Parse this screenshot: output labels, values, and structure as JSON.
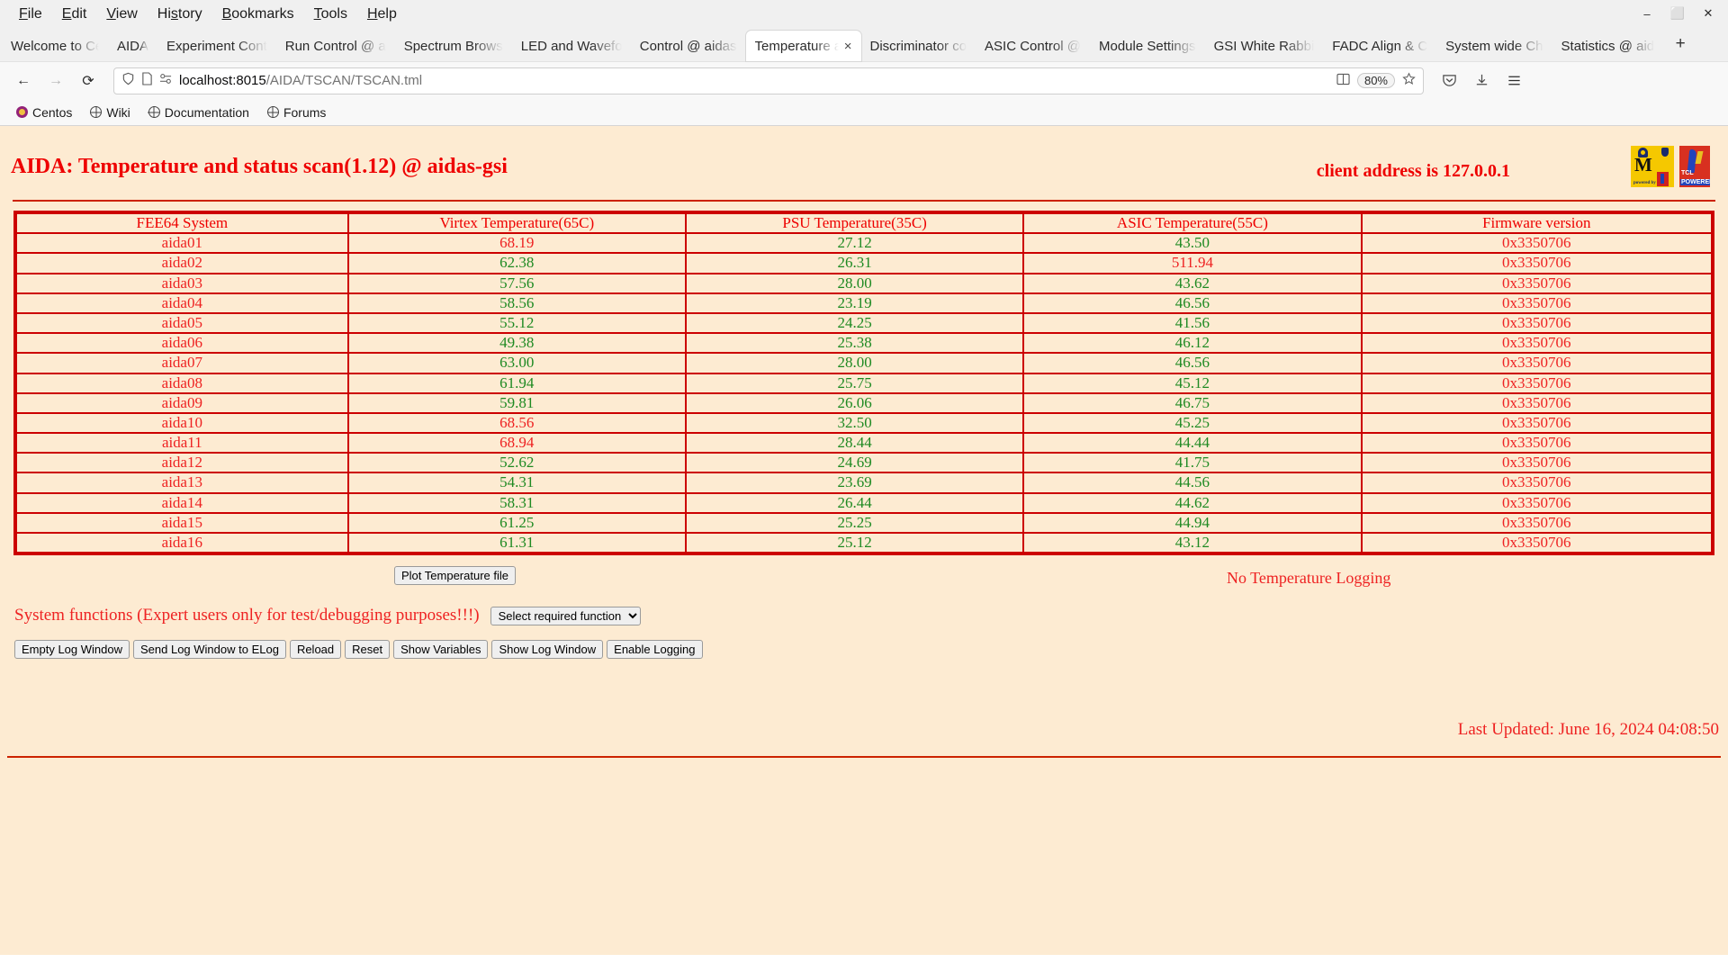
{
  "browser": {
    "menu": [
      {
        "label": "File",
        "accel": "F"
      },
      {
        "label": "Edit",
        "accel": "E"
      },
      {
        "label": "View",
        "accel": "V"
      },
      {
        "label": "History",
        "accel": "s"
      },
      {
        "label": "Bookmarks",
        "accel": "B"
      },
      {
        "label": "Tools",
        "accel": "T"
      },
      {
        "label": "Help",
        "accel": "H"
      }
    ],
    "window_controls": {
      "minimize": "–",
      "maximize": "⬜",
      "close": "✕"
    },
    "tabs": [
      {
        "label": "Welcome to Cent",
        "active": false
      },
      {
        "label": "AIDA",
        "active": false
      },
      {
        "label": "Experiment Cont",
        "active": false
      },
      {
        "label": "Run Control @ a",
        "active": false
      },
      {
        "label": "Spectrum Brows",
        "active": false
      },
      {
        "label": "LED and Wavefo",
        "active": false
      },
      {
        "label": "Control @ aidas",
        "active": false
      },
      {
        "label": "Temperature a",
        "active": true
      },
      {
        "label": "Discriminator co",
        "active": false
      },
      {
        "label": "ASIC Control @",
        "active": false
      },
      {
        "label": "Module Settings",
        "active": false
      },
      {
        "label": "GSI White Rabbi",
        "active": false
      },
      {
        "label": "FADC Align & C",
        "active": false
      },
      {
        "label": "System wide Ch",
        "active": false
      },
      {
        "label": "Statistics @ aid",
        "active": false
      }
    ],
    "new_tab_label": "+",
    "tab_close_label": "×",
    "nav": {
      "back": "←",
      "forward": "→",
      "reload": "⟳"
    },
    "url": {
      "host": "localhost:8015",
      "path": "/AIDA/TSCAN/TSCAN.tml"
    },
    "zoom": "80%",
    "bookmarks": [
      {
        "label": "Centos",
        "icon": "centos-icon"
      },
      {
        "label": "Wiki",
        "icon": "globe-icon"
      },
      {
        "label": "Documentation",
        "icon": "globe-icon"
      },
      {
        "label": "Forums",
        "icon": "globe-icon"
      }
    ]
  },
  "page": {
    "title": "AIDA: Temperature and status scan(1.12) @ aidas-gsi",
    "client_address": "client address is 127.0.0.1",
    "logging_status": "No Temperature Logging",
    "plot_button": "Plot Temperature file",
    "sysfunc_label": "System functions (Expert users only for test/debugging purposes!!!)",
    "sysfunc_selected": "Select required function",
    "sysfunc_options": [
      "Select required function"
    ],
    "action_buttons": [
      "Empty Log Window",
      "Send Log Window to ELog",
      "Reload",
      "Reset",
      "Show Variables",
      "Show Log Window",
      "Enable Logging"
    ],
    "last_updated": "Last Updated: June 16, 2024 04:08:50",
    "colors": {
      "ok": "#1e8a22",
      "alarm": "#ee2222",
      "background": "#fdebd2",
      "border": "#cc0000"
    }
  },
  "table": {
    "headers": [
      "FEE64 System",
      "Virtex Temperature(65C)",
      "PSU Temperature(35C)",
      "ASIC Temperature(55C)",
      "Firmware version"
    ],
    "rows": [
      {
        "system": "aida01",
        "virtex": "68.19",
        "virtex_state": "alarm",
        "psu": "27.12",
        "psu_state": "ok",
        "asic": "43.50",
        "asic_state": "ok",
        "firmware": "0x3350706"
      },
      {
        "system": "aida02",
        "virtex": "62.38",
        "virtex_state": "ok",
        "psu": "26.31",
        "psu_state": "ok",
        "asic": "511.94",
        "asic_state": "alarm",
        "firmware": "0x3350706"
      },
      {
        "system": "aida03",
        "virtex": "57.56",
        "virtex_state": "ok",
        "psu": "28.00",
        "psu_state": "ok",
        "asic": "43.62",
        "asic_state": "ok",
        "firmware": "0x3350706"
      },
      {
        "system": "aida04",
        "virtex": "58.56",
        "virtex_state": "ok",
        "psu": "23.19",
        "psu_state": "ok",
        "asic": "46.56",
        "asic_state": "ok",
        "firmware": "0x3350706"
      },
      {
        "system": "aida05",
        "virtex": "55.12",
        "virtex_state": "ok",
        "psu": "24.25",
        "psu_state": "ok",
        "asic": "41.56",
        "asic_state": "ok",
        "firmware": "0x3350706"
      },
      {
        "system": "aida06",
        "virtex": "49.38",
        "virtex_state": "ok",
        "psu": "25.38",
        "psu_state": "ok",
        "asic": "46.12",
        "asic_state": "ok",
        "firmware": "0x3350706"
      },
      {
        "system": "aida07",
        "virtex": "63.00",
        "virtex_state": "ok",
        "psu": "28.00",
        "psu_state": "ok",
        "asic": "46.56",
        "asic_state": "ok",
        "firmware": "0x3350706"
      },
      {
        "system": "aida08",
        "virtex": "61.94",
        "virtex_state": "ok",
        "psu": "25.75",
        "psu_state": "ok",
        "asic": "45.12",
        "asic_state": "ok",
        "firmware": "0x3350706"
      },
      {
        "system": "aida09",
        "virtex": "59.81",
        "virtex_state": "ok",
        "psu": "26.06",
        "psu_state": "ok",
        "asic": "46.75",
        "asic_state": "ok",
        "firmware": "0x3350706"
      },
      {
        "system": "aida10",
        "virtex": "68.56",
        "virtex_state": "alarm",
        "psu": "32.50",
        "psu_state": "ok",
        "asic": "45.25",
        "asic_state": "ok",
        "firmware": "0x3350706"
      },
      {
        "system": "aida11",
        "virtex": "68.94",
        "virtex_state": "alarm",
        "psu": "28.44",
        "psu_state": "ok",
        "asic": "44.44",
        "asic_state": "ok",
        "firmware": "0x3350706"
      },
      {
        "system": "aida12",
        "virtex": "52.62",
        "virtex_state": "ok",
        "psu": "24.69",
        "psu_state": "ok",
        "asic": "41.75",
        "asic_state": "ok",
        "firmware": "0x3350706"
      },
      {
        "system": "aida13",
        "virtex": "54.31",
        "virtex_state": "ok",
        "psu": "23.69",
        "psu_state": "ok",
        "asic": "44.56",
        "asic_state": "ok",
        "firmware": "0x3350706"
      },
      {
        "system": "aida14",
        "virtex": "58.31",
        "virtex_state": "ok",
        "psu": "26.44",
        "psu_state": "ok",
        "asic": "44.62",
        "asic_state": "ok",
        "firmware": "0x3350706"
      },
      {
        "system": "aida15",
        "virtex": "61.25",
        "virtex_state": "ok",
        "psu": "25.25",
        "psu_state": "ok",
        "asic": "44.94",
        "asic_state": "ok",
        "firmware": "0x3350706"
      },
      {
        "system": "aida16",
        "virtex": "61.31",
        "virtex_state": "ok",
        "psu": "25.12",
        "psu_state": "ok",
        "asic": "43.12",
        "asic_state": "ok",
        "firmware": "0x3350706"
      }
    ]
  }
}
